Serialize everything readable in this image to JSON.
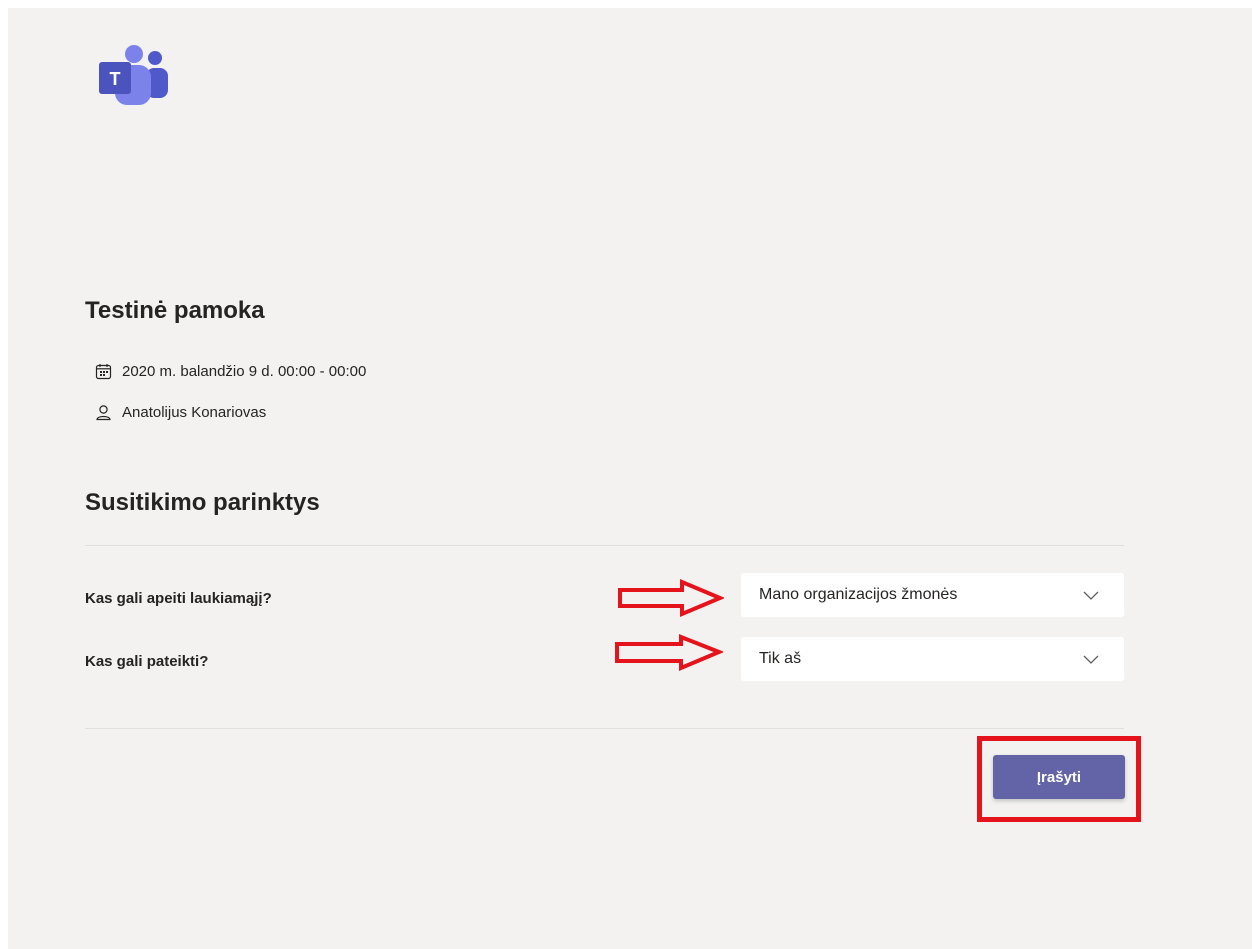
{
  "meeting": {
    "title": "Testinė pamoka",
    "datetime": "2020 m. balandžio 9 d. 00:00 - 00:00",
    "organizer": "Anatolijus Konariovas"
  },
  "options": {
    "section_title": "Susitikimo parinktys",
    "items": [
      {
        "label": "Kas gali apeiti laukiamąjį?",
        "value": "Mano organizacijos žmonės"
      },
      {
        "label": "Kas gali pateikti?",
        "value": "Tik aš"
      }
    ]
  },
  "actions": {
    "save_label": "Įrašyti"
  },
  "icons": {
    "logo": "microsoft-teams-logo",
    "date": "calendar-icon",
    "organizer": "person-icon",
    "dropdown": "chevron-down-icon"
  },
  "colors": {
    "page_background": "#f3f2f1",
    "accent": "#6264a7",
    "annotation": "#e5141c"
  }
}
